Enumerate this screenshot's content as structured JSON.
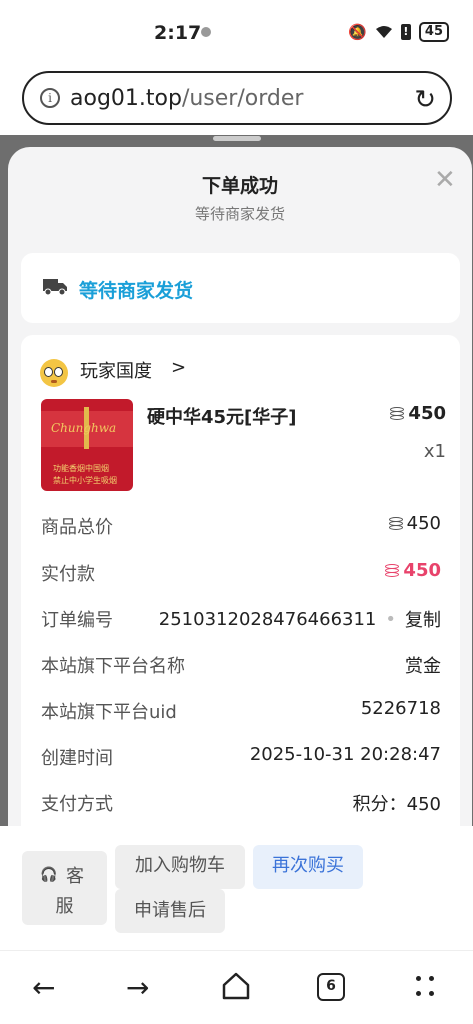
{
  "status": {
    "time": "2:17",
    "battery": "45"
  },
  "browser": {
    "url_domain": "aog01.top",
    "url_path": "/user/order",
    "tab_count": "6"
  },
  "sheet": {
    "title": "下单成功",
    "subtitle": "等待商家发货"
  },
  "shipping": {
    "status": "等待商家发货"
  },
  "shop": {
    "name": "玩家国度",
    "chevron": ">"
  },
  "product": {
    "name": "硬中华45元[华子]",
    "price": "450",
    "qty": "x1",
    "img_text": [
      "功能香烟中国烟",
      "禁止中小学生吸烟"
    ],
    "img_brand": "Chunghwa"
  },
  "details": {
    "total_label": "商品总价",
    "total_value": "450",
    "paid_label": "实付款",
    "paid_value": "450",
    "order_label": "订单编号",
    "order_value": "2510312028476466311",
    "copy_label": "复制",
    "platform_label": "本站旗下平台名称",
    "platform_value": "赏金",
    "uid_label": "本站旗下平台uid",
    "uid_value": "5226718",
    "created_label": "创建时间",
    "created_value": "2025-10-31 20:28:47",
    "payment_label": "支付方式",
    "payment_value": "积分：450"
  },
  "actions": {
    "service_1": "客",
    "service_2": "服",
    "add_cart": "加入购物车",
    "buy_again": "再次购买",
    "after_sale": "申请售后"
  },
  "colors": {
    "accent_blue": "#1a9fd8",
    "price_red": "#e8436b",
    "buy_again_text": "#3b73d8"
  }
}
